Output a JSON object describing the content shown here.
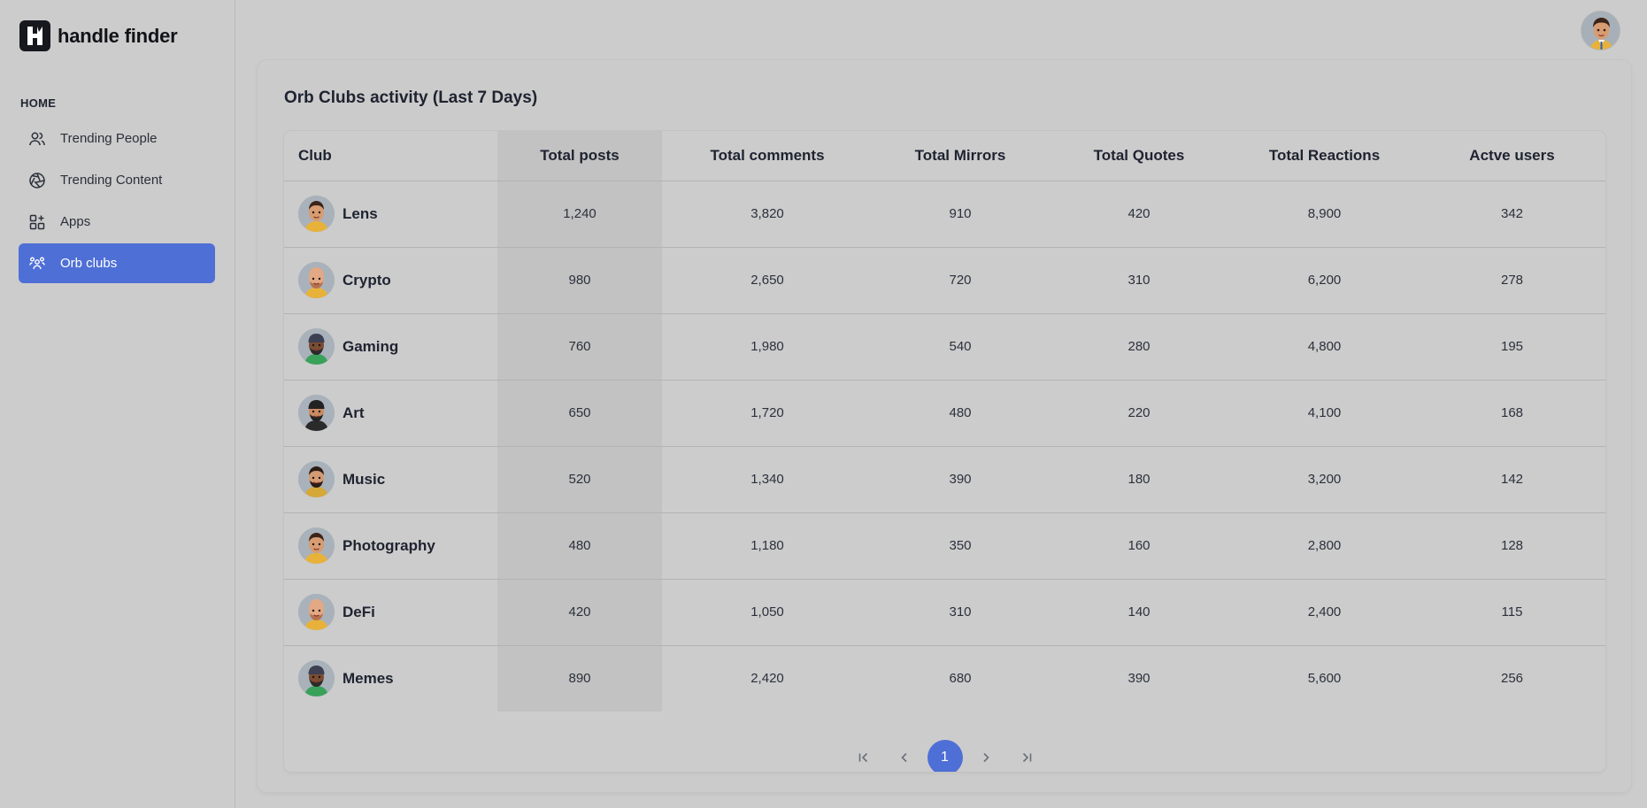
{
  "brand": {
    "name": "handle finder"
  },
  "sidebar": {
    "section": "HOME",
    "items": [
      {
        "label": "Trending People",
        "icon": "users-icon",
        "active": false
      },
      {
        "label": "Trending Content",
        "icon": "aperture-icon",
        "active": false
      },
      {
        "label": "Apps",
        "icon": "apps-grid-icon",
        "active": false
      },
      {
        "label": "Orb clubs",
        "icon": "group-icon",
        "active": true
      }
    ]
  },
  "main": {
    "title": "Orb Clubs activity (Last 7 Days)",
    "columns": [
      "Club",
      "Total posts",
      "Total comments",
      "Total Mirrors",
      "Total Quotes",
      "Total Reactions",
      "Actve users"
    ],
    "rows": [
      {
        "club": "Lens",
        "avatar": "man-yellow-shirt-avatar",
        "posts": "1,240",
        "comments": "3,820",
        "mirrors": "910",
        "quotes": "420",
        "reactions": "8,900",
        "users": "342"
      },
      {
        "club": "Crypto",
        "avatar": "bald-man-avatar",
        "posts": "980",
        "comments": "2,650",
        "mirrors": "720",
        "quotes": "310",
        "reactions": "6,200",
        "users": "278"
      },
      {
        "club": "Gaming",
        "avatar": "beanie-man-avatar",
        "posts": "760",
        "comments": "1,980",
        "mirrors": "540",
        "quotes": "280",
        "reactions": "4,800",
        "users": "195"
      },
      {
        "club": "Art",
        "avatar": "cap-man-avatar",
        "posts": "650",
        "comments": "1,720",
        "mirrors": "480",
        "quotes": "220",
        "reactions": "4,100",
        "users": "168"
      },
      {
        "club": "Music",
        "avatar": "bearded-man-avatar",
        "posts": "520",
        "comments": "1,340",
        "mirrors": "390",
        "quotes": "180",
        "reactions": "3,200",
        "users": "142"
      },
      {
        "club": "Photography",
        "avatar": "man-yellow-shirt-avatar",
        "posts": "480",
        "comments": "1,180",
        "mirrors": "350",
        "quotes": "160",
        "reactions": "2,800",
        "users": "128"
      },
      {
        "club": "DeFi",
        "avatar": "bald-man-avatar",
        "posts": "420",
        "comments": "1,050",
        "mirrors": "310",
        "quotes": "140",
        "reactions": "2,400",
        "users": "115"
      },
      {
        "club": "Memes",
        "avatar": "beanie-man-avatar",
        "posts": "890",
        "comments": "2,420",
        "mirrors": "680",
        "quotes": "390",
        "reactions": "5,600",
        "users": "256"
      }
    ]
  },
  "pagination": {
    "first_icon": "first-page-icon",
    "prev_icon": "chevron-left-icon",
    "current_page": "1",
    "next_icon": "chevron-right-icon",
    "last_icon": "last-page-icon"
  },
  "colors": {
    "accent": "#4e6fd6",
    "background": "#cccccc",
    "highlight_column": "#c2c2c2"
  }
}
